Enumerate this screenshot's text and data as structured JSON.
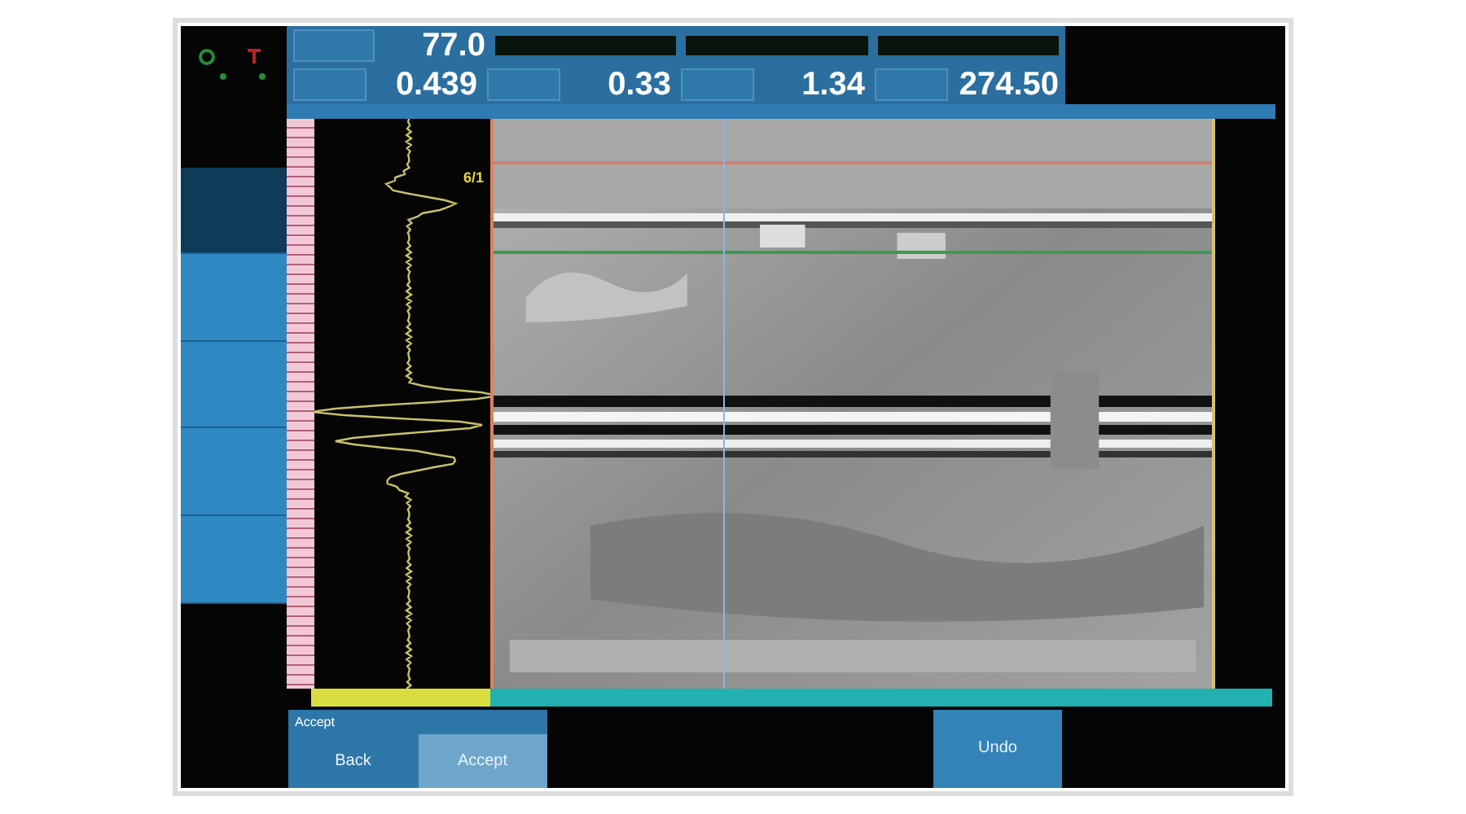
{
  "top_panel": {
    "gain": {
      "value": "77.0"
    },
    "status_fields": [
      {
        "kind": "field"
      },
      {
        "kind": "field"
      },
      {
        "kind": "field"
      }
    ],
    "readings": [
      {
        "value": "0.439"
      },
      {
        "value": "0.33"
      },
      {
        "value": "1.34"
      },
      {
        "value": "274.50"
      }
    ]
  },
  "sidebar": {
    "items": [
      {
        "selected": true
      },
      {
        "selected": false
      },
      {
        "selected": false
      },
      {
        "selected": false
      },
      {
        "selected": false
      }
    ]
  },
  "ascan": {
    "gate_label": "6/1"
  },
  "bottom_bar": {
    "prompt": "Accept",
    "buttons": [
      {
        "label": "Back",
        "selected": false
      },
      {
        "label": "Accept",
        "selected": true
      }
    ],
    "undo": {
      "label": "Undo"
    }
  }
}
